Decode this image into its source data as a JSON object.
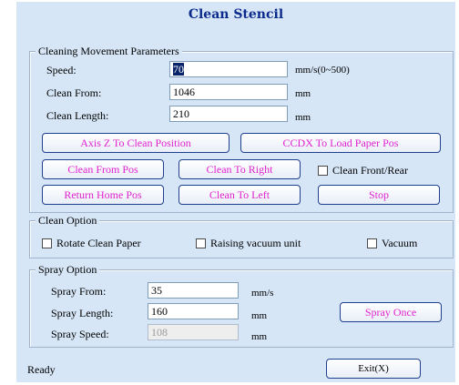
{
  "window": {
    "title": "Clean Stencil"
  },
  "cleaning_movement": {
    "legend": "Cleaning Movement Parameters",
    "speed_label": "Speed:",
    "speed_value": "70",
    "speed_unit": "mm/s(0~500)",
    "clean_from_label": "Clean From:",
    "clean_from_value": "1046",
    "clean_from_unit": "mm",
    "clean_length_label": "Clean Length:",
    "clean_length_value": "210",
    "clean_length_unit": "mm"
  },
  "buttons": {
    "axis_z": "Axis Z To Clean Position",
    "ccdx": "CCDX To Load Paper Pos",
    "clean_from_pos": "Clean From Pos",
    "clean_to_right": "Clean To Right",
    "return_home": "Return Home Pos",
    "clean_to_left": "Clean To Left",
    "stop": "Stop",
    "spray_once": "Spray Once",
    "exit": "Exit(X)"
  },
  "checkboxes": {
    "clean_front_rear": "Clean Front/Rear",
    "rotate_clean_paper": "Rotate Clean Paper",
    "raising_vacuum_unit": "Raising vacuum unit",
    "vacuum": "Vacuum"
  },
  "clean_option": {
    "legend": "Clean Option"
  },
  "spray_option": {
    "legend": "Spray Option",
    "spray_from_label": "Spray From:",
    "spray_from_value": "35",
    "spray_from_unit": "mm/s",
    "spray_length_label": "Spray Length:",
    "spray_length_value": "160",
    "spray_length_unit": "mm",
    "spray_speed_label": "Spray Speed:",
    "spray_speed_value": "108",
    "spray_speed_unit": "mm"
  },
  "status": {
    "text": "Ready"
  },
  "colors": {
    "background": "#d6e6f7",
    "title": "#0a2a8c",
    "button_text": "#e020d0",
    "button_border": "#1f3f8f"
  }
}
